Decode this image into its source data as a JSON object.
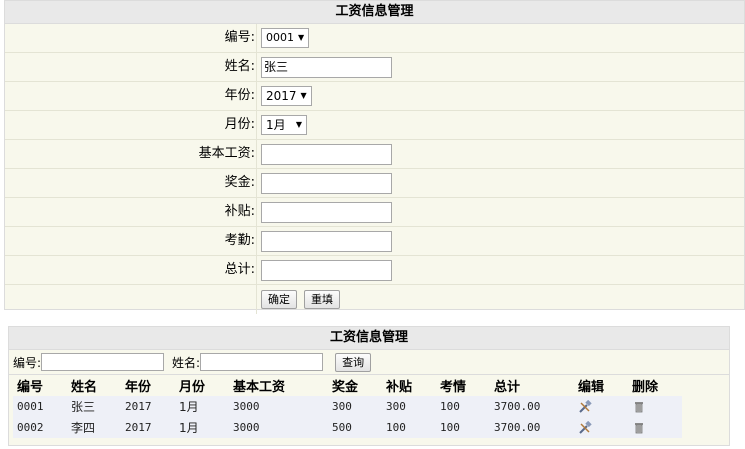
{
  "form": {
    "title": "工资信息管理",
    "fields": {
      "id": {
        "label": "编号:",
        "value": "0001"
      },
      "name": {
        "label": "姓名:",
        "value": "张三"
      },
      "year": {
        "label": "年份:",
        "value": "2017"
      },
      "month": {
        "label": "月份:",
        "value": "1月"
      },
      "base": {
        "label": "基本工资:",
        "value": ""
      },
      "bonus": {
        "label": "奖金:",
        "value": ""
      },
      "allow": {
        "label": "补贴:",
        "value": ""
      },
      "attend": {
        "label": "考勤:",
        "value": ""
      },
      "total": {
        "label": "总计:",
        "value": ""
      }
    },
    "confirm_label": "确定",
    "reset_label": "重填"
  },
  "list": {
    "title": "工资信息管理",
    "search": {
      "id_label": "编号:",
      "id_value": "",
      "name_label": "姓名:",
      "name_value": "",
      "query_label": "查询"
    },
    "columns": [
      "编号",
      "姓名",
      "年份",
      "月份",
      "基本工资",
      "奖金",
      "补贴",
      "考情",
      "总计",
      "编辑",
      "删除"
    ],
    "rows": [
      {
        "id": "0001",
        "name": "张三",
        "year": "2017",
        "month": "1月",
        "base": "3000",
        "bonus": "300",
        "allow": "300",
        "attend": "100",
        "total": "3700.00",
        "edit_icon": "edit-icon",
        "delete_icon": "trash-icon"
      },
      {
        "id": "0002",
        "name": "李四",
        "year": "2017",
        "month": "1月",
        "base": "3000",
        "bonus": "500",
        "allow": "100",
        "attend": "100",
        "total": "3700.00",
        "edit_icon": "edit-icon",
        "delete_icon": "trash-icon"
      }
    ]
  }
}
